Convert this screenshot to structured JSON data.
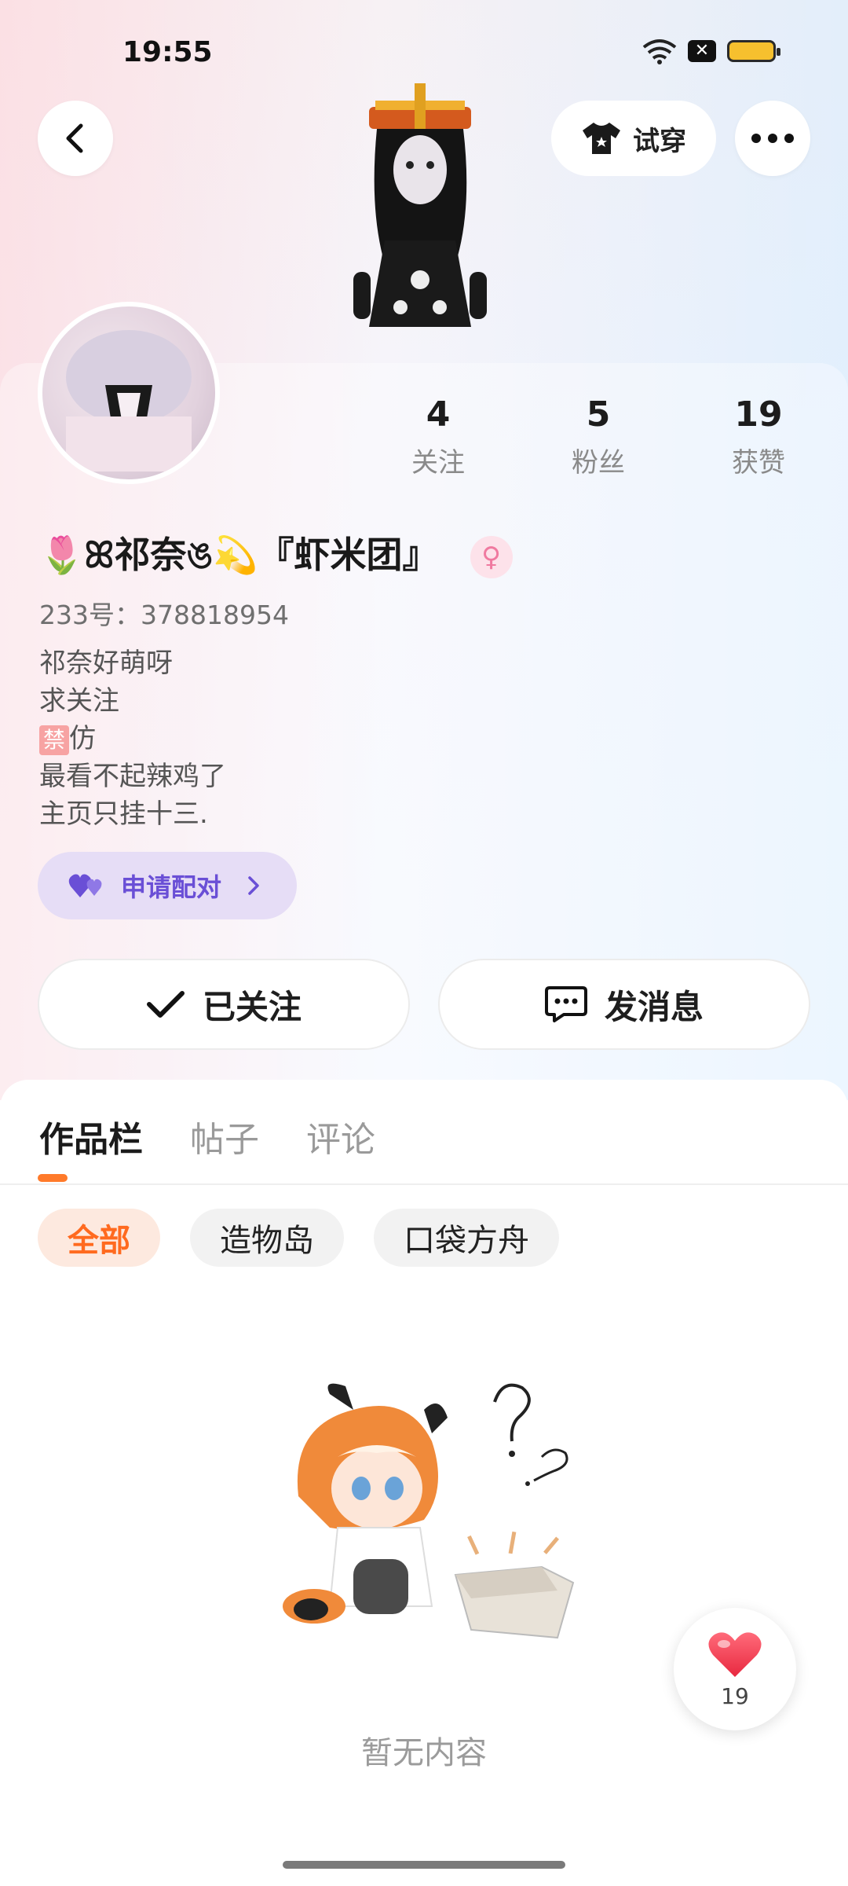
{
  "status_bar": {
    "time": "19:55",
    "notification": "✕"
  },
  "header": {
    "try_on_label": "试穿"
  },
  "profile": {
    "stats": [
      {
        "num": "4",
        "label": "关注"
      },
      {
        "num": "5",
        "label": "粉丝"
      },
      {
        "num": "19",
        "label": "获赞"
      }
    ],
    "name": "🌷ꕤ祁奈ঙ💫『虾米团』",
    "gender_symbol": "♀",
    "uid": "233号：378818954",
    "bio_lines": [
      "祁奈好萌呀",
      "求关注",
      "仿",
      "最看不起辣鸡了",
      "主页只挂十三."
    ],
    "ban_tag": "禁",
    "pair_label": "申请配对",
    "follow_label": "已关注",
    "message_label": "发消息"
  },
  "tabs": [
    "作品栏",
    "帖子",
    "评论"
  ],
  "chips": [
    "全部",
    "造物岛",
    "口袋方舟"
  ],
  "empty_text": "暂无内容",
  "like_fab": {
    "count": "19"
  },
  "colors": {
    "accent": "#ff6a1f",
    "pair_purple": "#6a4fd6",
    "like_red": "#f04a5a"
  }
}
